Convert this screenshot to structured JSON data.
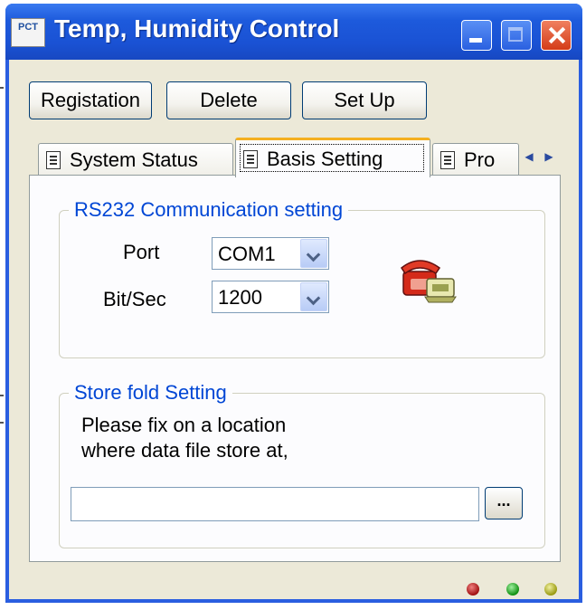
{
  "window": {
    "title": "Temp, Humidity Control",
    "icon_label": "PCT"
  },
  "toolbar": {
    "registation_label": "Registation",
    "delete_label": "Delete",
    "setup_label": "Set Up"
  },
  "tabs": [
    {
      "label": "System Status",
      "icon": "document-icon",
      "selected": false
    },
    {
      "label": "Basis Setting",
      "icon": "document-icon",
      "selected": true
    },
    {
      "label": "Pro",
      "icon": "document-icon",
      "selected": false
    }
  ],
  "rs232": {
    "legend": "RS232 Communication setting",
    "port_label": "Port",
    "port_value": "COM1",
    "bitsec_label": "Bit/Sec",
    "bitsec_value": "1200",
    "icon": "telephone-icon"
  },
  "store": {
    "legend": "Store fold Setting",
    "desc_line1": "Please fix on a location",
    "desc_line2": "where data file store at,",
    "path_value": "",
    "browse_label": "..."
  },
  "status_leds": [
    {
      "name": "red",
      "color": "#c01010"
    },
    {
      "name": "green",
      "color": "#10a010"
    },
    {
      "name": "yellow",
      "color": "#a0a010"
    }
  ]
}
